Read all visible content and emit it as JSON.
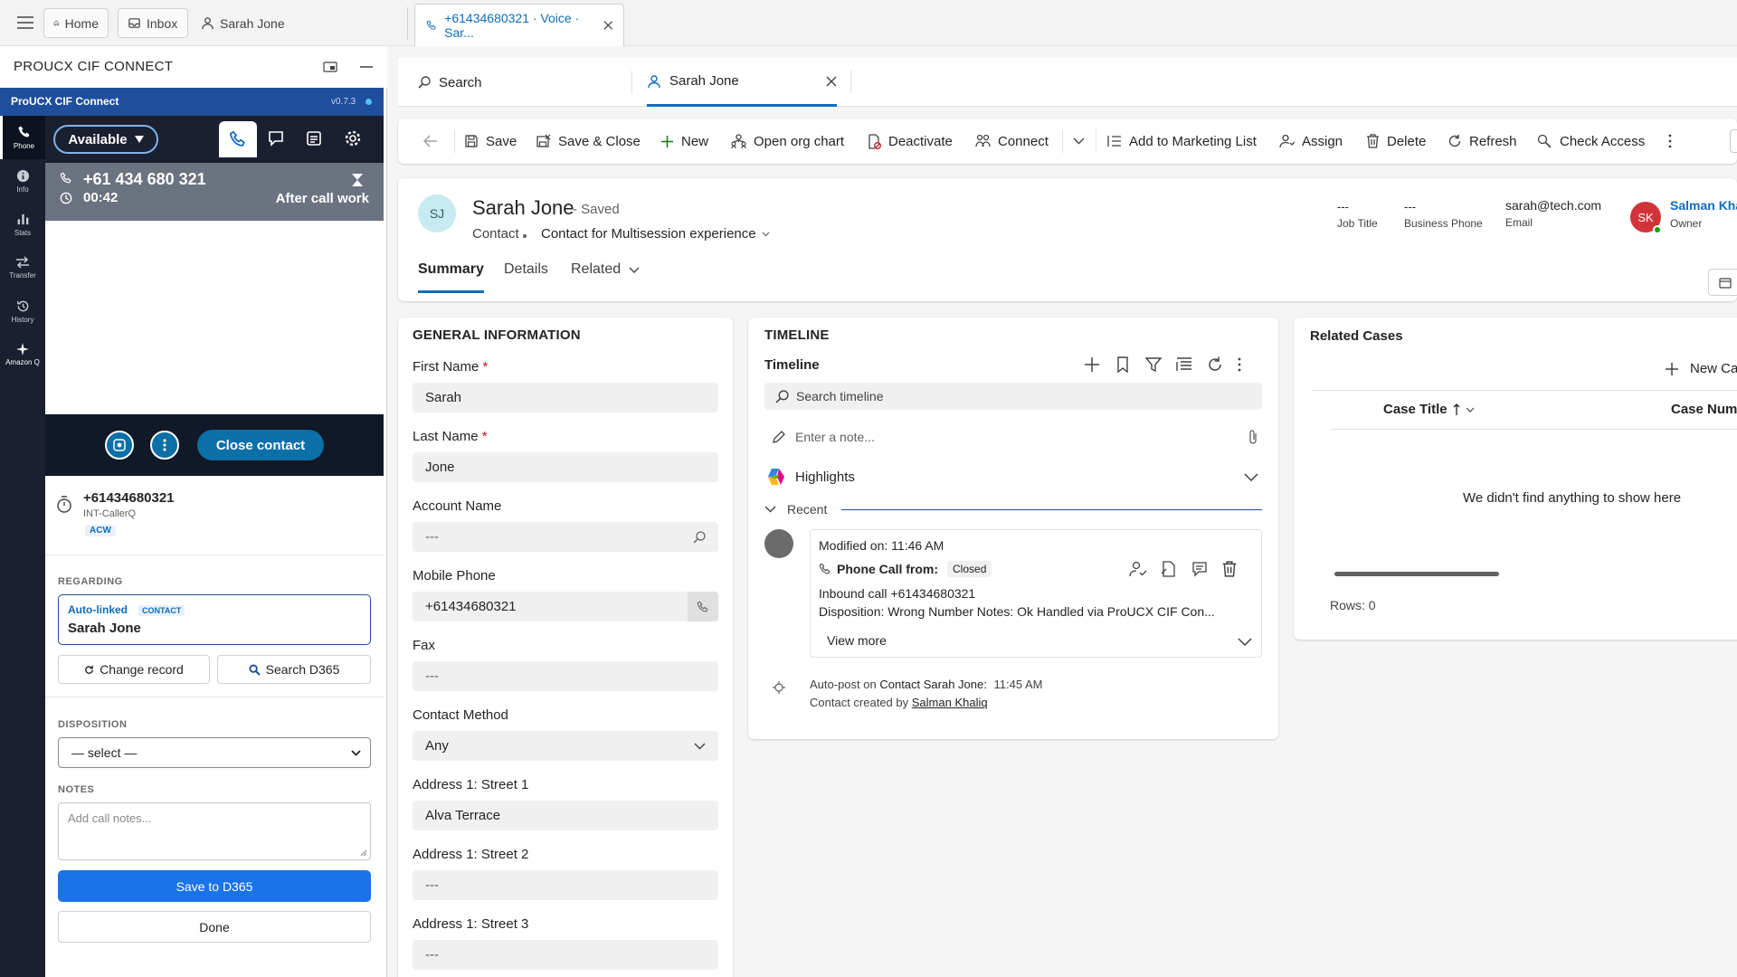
{
  "topbar": {
    "home": "Home",
    "inbox": "Inbox",
    "user_tab": "Sarah Jone",
    "session_tab": "+61434680321 · Voice · Sar..."
  },
  "cti": {
    "header_title": "PROUCX CIF CONNECT",
    "brand": "ProUCX CIF Connect",
    "version": "v0.7.3",
    "rail": [
      "Phone",
      "Info",
      "Stats",
      "Transfer",
      "History",
      "Amazon Q"
    ],
    "status": "Available",
    "call_number": "+61 434 680 321",
    "call_timer": "00:42",
    "call_state": "After call work",
    "close_contact": "Close contact",
    "caller_number": "+61434680321",
    "caller_queue": "INT-CallerQ",
    "caller_badge": "ACW",
    "regarding_label": "REGARDING",
    "auto_linked": "Auto-linked",
    "contact_tag": "CONTACT",
    "linked_name": "Sarah Jone",
    "change_record": "Change record",
    "search_d365": "Search D365",
    "disposition_label": "DISPOSITION",
    "disposition_value": "— select —",
    "notes_label": "NOTES",
    "notes_placeholder": "Add call notes...",
    "save_btn": "Save to D365",
    "done_btn": "Done",
    "colors": {
      "rail_bg": "#1b2030",
      "brand_bg": "#1f4e9c",
      "call_bar": "#6b7280",
      "close_btn": "#0b6fa8",
      "save_btn": "#1a73e8"
    }
  },
  "tabs": {
    "search": "Search",
    "record": "Sarah Jone"
  },
  "commands": [
    "Save",
    "Save & Close",
    "New",
    "Open org chart",
    "Deactivate",
    "Connect",
    "Add to Marketing List",
    "Assign",
    "Delete",
    "Refresh",
    "Check Access"
  ],
  "record": {
    "initials": "SJ",
    "name": "Sarah Jone",
    "saved": "- Saved",
    "entity": "Contact",
    "form": "Contact for Multisession experience",
    "job_title_value": "---",
    "job_title_label": "Job Title",
    "business_phone_value": "---",
    "business_phone_label": "Business Phone",
    "email_value": "sarah@tech.com",
    "email_label": "Email",
    "owner_initials": "SK",
    "owner_name": "Salman Kha",
    "owner_label": "Owner",
    "form_tabs": [
      "Summary",
      "Details",
      "Related"
    ]
  },
  "general": {
    "title": "GENERAL INFORMATION",
    "fields": [
      {
        "label": "First Name",
        "value": "Sarah",
        "required": "*"
      },
      {
        "label": "Last Name",
        "value": "Jone",
        "required": "*"
      },
      {
        "label": "Account Name",
        "value": "---"
      },
      {
        "label": "Mobile Phone",
        "value": "+61434680321"
      },
      {
        "label": "Fax",
        "value": "---"
      },
      {
        "label": "Contact Method",
        "value": "Any"
      },
      {
        "label": "Address 1: Street 1",
        "value": "Alva Terrace"
      },
      {
        "label": "Address 1: Street 2",
        "value": "---"
      },
      {
        "label": "Address 1: Street 3",
        "value": "---"
      }
    ]
  },
  "timeline": {
    "title": "TIMELINE",
    "subtitle": "Timeline",
    "search_placeholder": "Search timeline",
    "note_placeholder": "Enter a note...",
    "highlights": "Highlights",
    "recent": "Recent",
    "modified": "Modified on: 11:46 AM",
    "call_from": "Phone Call from:",
    "status": "Closed",
    "line1": "Inbound call +61434680321",
    "line2": "Disposition: Wrong Number Notes: Ok Handled via ProUCX CIF Con...",
    "view_more": "View more",
    "autopost_prefix": "Auto-post on",
    "autopost_subject": "Contact Sarah Jone:",
    "autopost_time": "11:45 AM",
    "created_by": "Contact created by",
    "created_user": "Salman Khaliq"
  },
  "related": {
    "title": "Related Cases",
    "new": "New Ca",
    "col1": "Case Title",
    "col2": "Case Numb",
    "empty": "We didn't find anything to show here",
    "rows": "Rows: 0"
  }
}
